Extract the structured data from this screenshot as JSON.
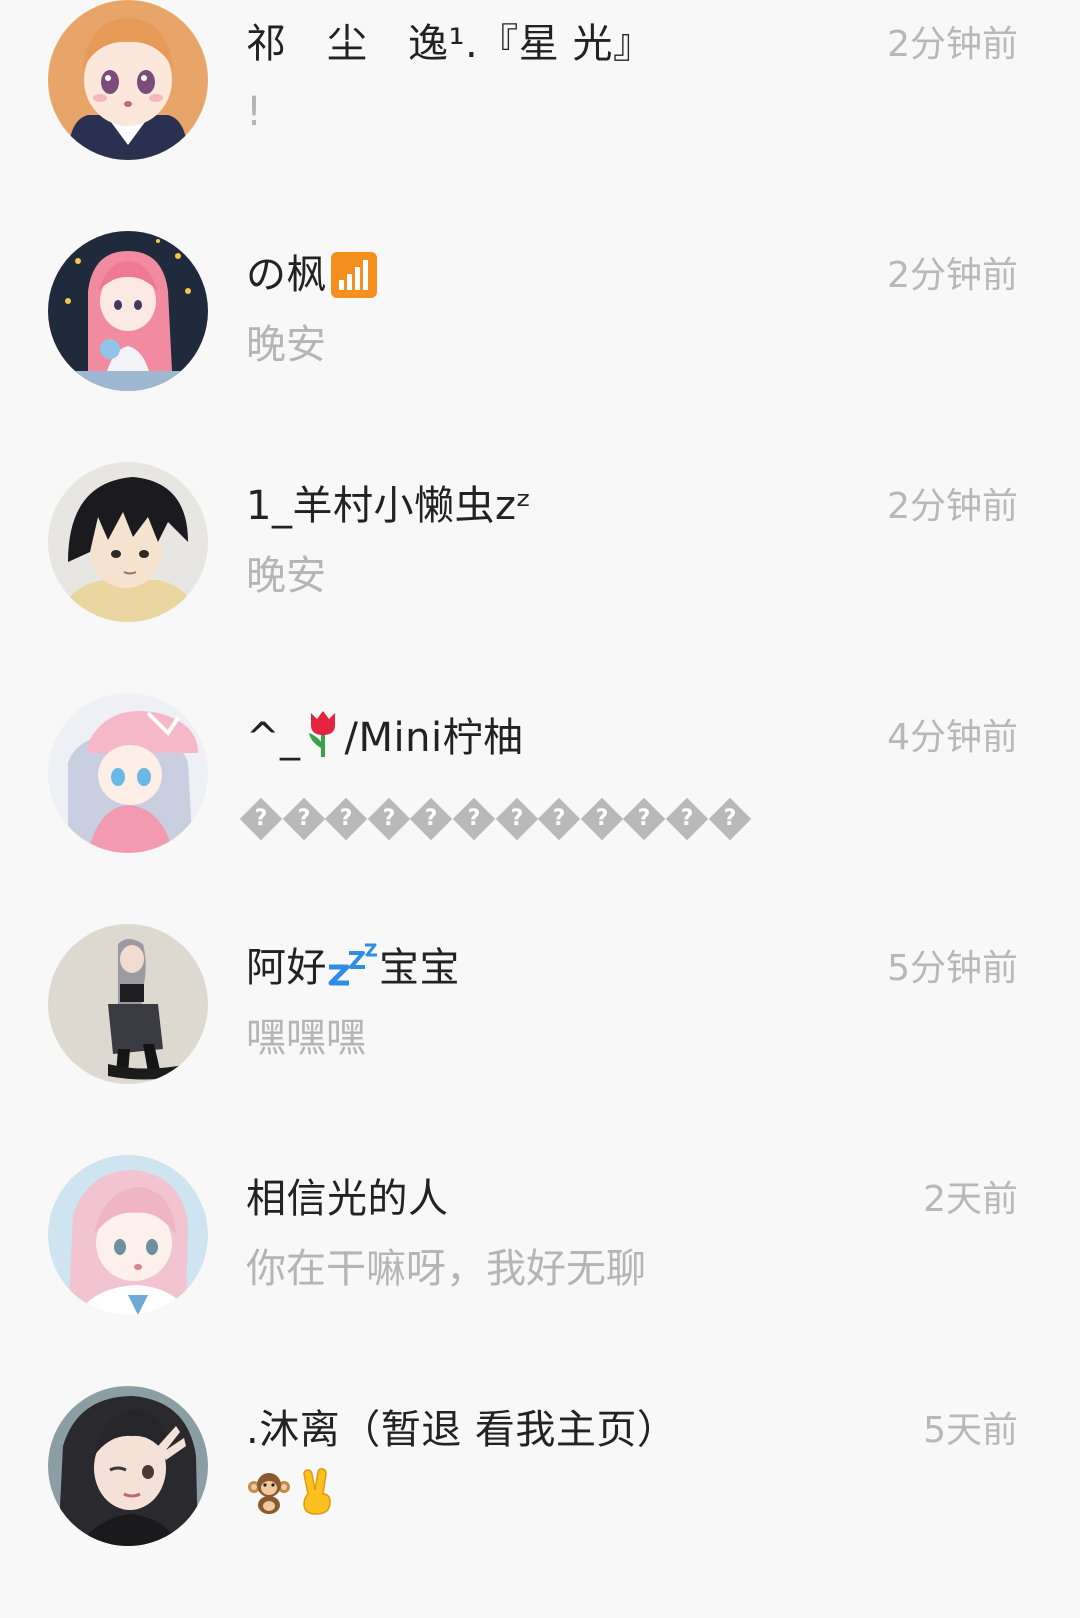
{
  "conversations": [
    {
      "name": "祁　尘　逸¹.『星 光』",
      "preview": "!",
      "time": "2分钟前",
      "avatar_icon": "anime-girl-orange-hair-avatar"
    },
    {
      "name": "の枫",
      "name_icon": "signal-bars-icon",
      "preview": "晚安",
      "time": "2分钟前",
      "avatar_icon": "anime-girl-pink-hair-stars-avatar"
    },
    {
      "name": "1_羊村小懒虫zᶻ",
      "preview": "晚安",
      "time": "2分钟前",
      "avatar_icon": "anime-boy-dark-hair-avatar"
    },
    {
      "name_prefix": "^_",
      "name_icon": "tulip-icon",
      "name_suffix": "/Mini柠柚",
      "preview": "�������������",
      "time": "4分钟前",
      "avatar_icon": "anime-girl-pink-cap-avatar"
    },
    {
      "name_prefix": "阿好",
      "name_icon": "zzz-icon",
      "name_suffix": "宝宝",
      "preview": "嘿嘿嘿",
      "time": "5分钟前",
      "avatar_icon": "anime-girl-sitting-avatar"
    },
    {
      "name": "相信光的人",
      "preview": "你在干嘛呀，我好无聊",
      "time": "2天前",
      "avatar_icon": "anime-girl-pink-short-hair-avatar"
    },
    {
      "name": ".沐离（暂退  看我主页）",
      "preview_icons": [
        "monkey-icon",
        "victory-hand-icon"
      ],
      "time": "5天前",
      "avatar_icon": "anime-girl-wink-avatar"
    }
  ],
  "colors": {
    "background": "#f8f8f8",
    "name_text": "#222222",
    "preview_text": "#b5b5b5",
    "time_text": "#b8b8b8",
    "signal_orange": "#f5901e"
  }
}
